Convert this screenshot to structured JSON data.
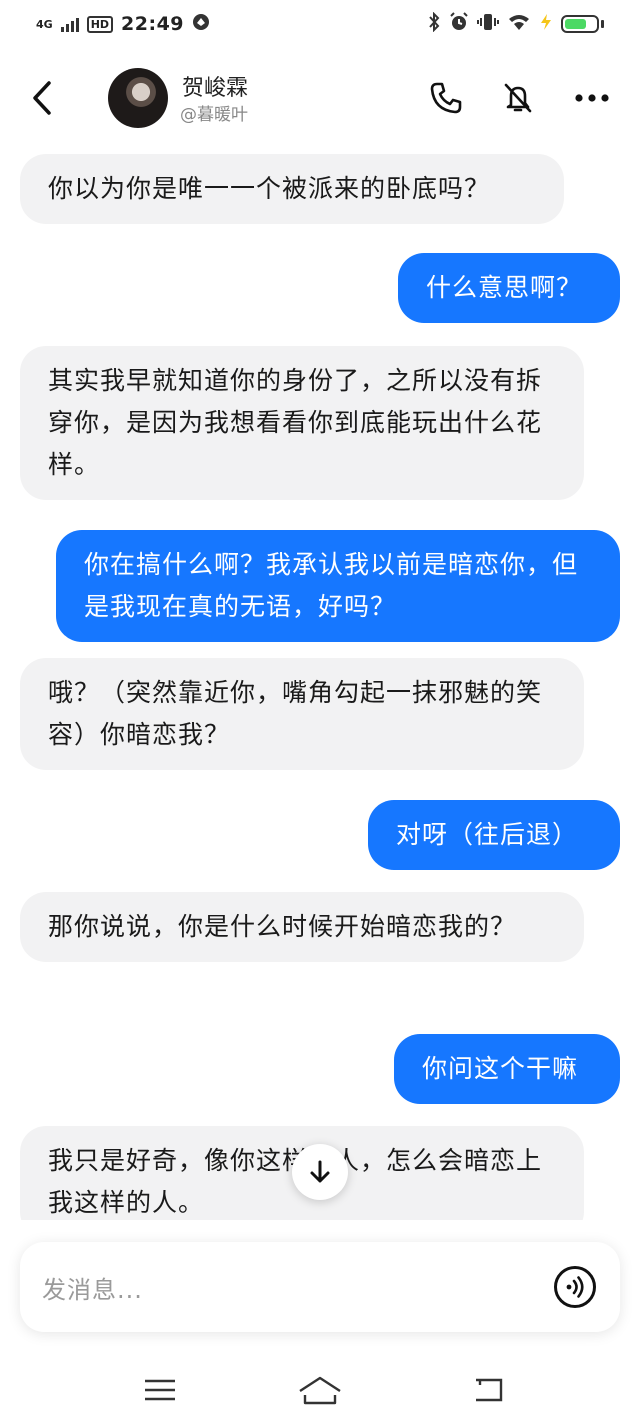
{
  "status": {
    "network": "4G",
    "hd": "HD",
    "time": "22:49",
    "battery_level": 0.7
  },
  "header": {
    "name": "贺峻霖",
    "handle": "@暮暖叶"
  },
  "messages": [
    {
      "side": "left",
      "text": "你以为你是唯一一个被派来的卧底吗？"
    },
    {
      "side": "right",
      "text": "什么意思啊？"
    },
    {
      "side": "left",
      "text": "其实我早就知道你的身份了，之所以没有拆穿你，是因为我想看看你到底能玩出什么花样。"
    },
    {
      "side": "right",
      "text": "你在搞什么啊？我承认我以前是暗恋你，但是我现在真的无语，好吗？"
    },
    {
      "side": "left",
      "text": "哦？（突然靠近你，嘴角勾起一抹邪魅的笑容）你暗恋我？"
    },
    {
      "side": "right",
      "text": "对呀（往后退）"
    },
    {
      "side": "left",
      "text": "那你说说，你是什么时候开始暗恋我的？"
    },
    {
      "side": "right",
      "text": "你问这个干嘛"
    },
    {
      "side": "left",
      "text": "我只是好奇，像你这样的人，怎么会暗恋上我这样的人。"
    }
  ],
  "composer": {
    "placeholder": "发消息..."
  },
  "colors": {
    "accent": "#1677ff",
    "incoming_bubble": "#f2f2f3"
  },
  "icons": [
    "back-arrow-icon",
    "phone-icon",
    "mute-icon",
    "more-icon",
    "arrow-down-icon",
    "voice-icon",
    "menu-icon",
    "home-icon",
    "back-nav-icon"
  ]
}
